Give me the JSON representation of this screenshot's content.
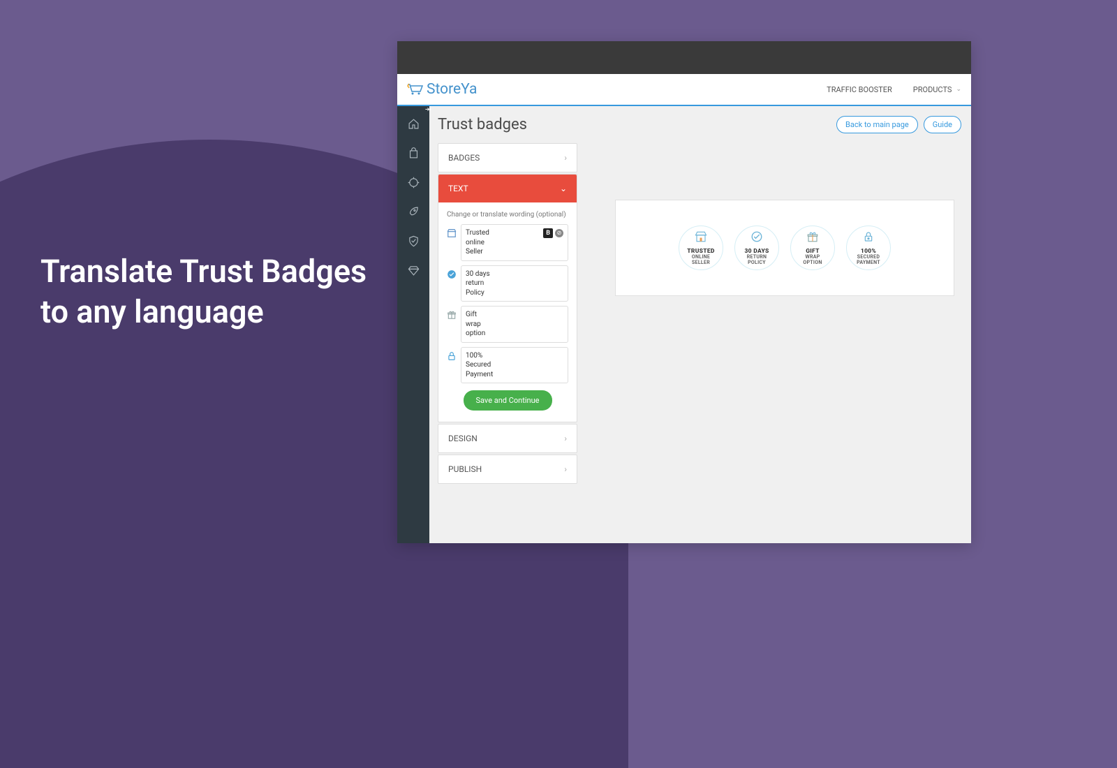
{
  "headline": "Translate Trust Badges\nto any language",
  "logo": {
    "text": "StoreYa"
  },
  "nav": {
    "traffic": "TRAFFIC BOOSTER",
    "products": "PRODUCTS"
  },
  "page": {
    "title": "Trust badges",
    "back_btn": "Back to main page",
    "guide_btn": "Guide"
  },
  "accordion": {
    "badges": "BADGES",
    "text": "TEXT",
    "design": "DESIGN",
    "publish": "PUBLISH"
  },
  "text_panel": {
    "help": "Change or translate wording (optional)",
    "fields": [
      {
        "lines": "Trusted\nonline\nSeller",
        "bold": true
      },
      {
        "lines": "30 days\nreturn\nPolicy"
      },
      {
        "lines": "Gift\nwrap\noption"
      },
      {
        "lines": "100%\nSecured\nPayment"
      }
    ],
    "save": "Save and Continue"
  },
  "preview_badges": [
    {
      "title": "TRUSTED",
      "sub": "ONLINE\nSELLER"
    },
    {
      "title": "30 DAYS",
      "sub": "RETURN\nPOLICY"
    },
    {
      "title": "GIFT",
      "sub": "WRAP\nOPTION"
    },
    {
      "title": "100%",
      "sub": "SECURED\nPAYMENT"
    }
  ]
}
